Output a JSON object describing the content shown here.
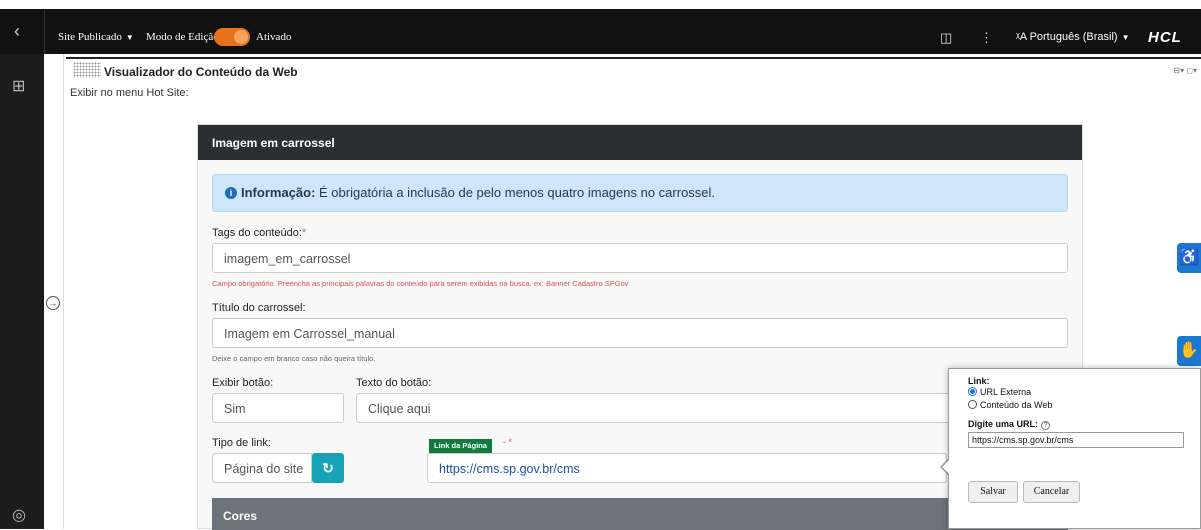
{
  "toolbar": {
    "back_icon": "‹",
    "site_published": "Site Publicado",
    "edit_mode_label": "Modo de Edição:",
    "edit_mode_state": "Ativado",
    "edit_mode_on": true,
    "language": "Português (Brasil)",
    "brand": "HCL"
  },
  "portlet": {
    "title": "Visualizador do Conteúdo da Web",
    "controls": "⊟▾ ◻▾",
    "hot_site": "Exibir no menu Hot Site:"
  },
  "panel": {
    "title": "Imagem em carrossel",
    "info_bold": "Informação:",
    "info_text": " É obrigatória a inclusão de pelo menos quatro imagens no carrossel.",
    "tags_label": "Tags do conteúdo:",
    "tags_value": "imagem_em_carrossel",
    "tags_hint": "Campo obrigatório. Preencha as principais palavras do conteúdo para serem exibidas na busca. ex: Banner Cadastro SPGov",
    "title_label": "Título do carrossel:",
    "title_value": "Imagem em Carrossel_manual",
    "title_hint": "Deixe o campo em branco caso não queira título.",
    "show_button_label": "Exibir botão:",
    "show_button_value": "Sim",
    "button_text_label": "Texto do botão:",
    "button_text_value": "Clique aqui",
    "link_type_label": "Tipo de link:",
    "link_type_value": "Página do site",
    "page_link_tag": "Link da Página",
    "page_link_value": "https://cms.sp.gov.br/cms",
    "colors_section": "Cores"
  },
  "popup": {
    "link_label": "Link:",
    "options": [
      "URL Externa",
      "Conteúdo da Web"
    ],
    "selected": 0,
    "url_label": "Digite uma URL:",
    "url_value": "https://cms.sp.gov.br/cms",
    "save": "Salvar",
    "cancel": "Cancelar"
  },
  "colors": {
    "toolbar_bg": "#111111",
    "toggle": "#e8731a",
    "panel_header": "#2b2f33",
    "info_bg": "#cfe5f9",
    "refresh_btn": "#17a2b8",
    "tag_green": "#137a3e",
    "accessibility_blue": "#1b78d0"
  }
}
